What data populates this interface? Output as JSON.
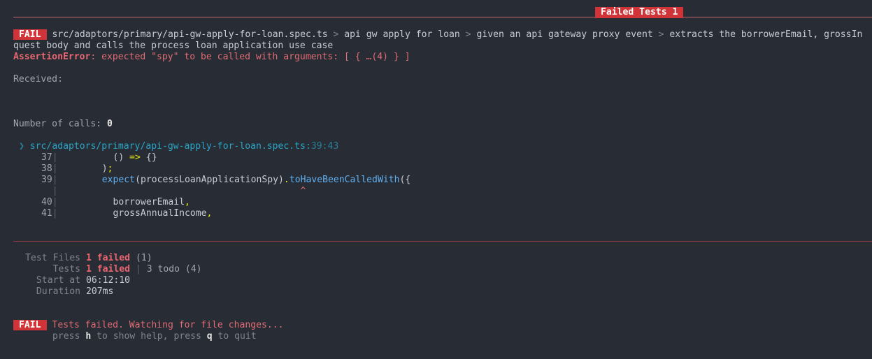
{
  "header": {
    "title": "Failed Tests 1"
  },
  "failure": {
    "badge": "FAIL",
    "file": "src/adaptors/primary/api-gw-apply-for-loan.spec.ts",
    "separator": ">",
    "suite": "api gw apply for loan",
    "describe": "given an api gateway proxy event",
    "test_line1": "extracts the borrowerEmail, grossIn",
    "test_line2": "quest body and calls the process loan application use case",
    "error_name": "AssertionError",
    "error_message": ": expected \"spy\" to be called with arguments: [ { …(4) } ]",
    "received_label": "Received:",
    "calls_label": "Number of calls: ",
    "calls_value": "0"
  },
  "location": {
    "arrow": "❯",
    "file": "src/adaptors/primary/api-gw-apply-for-loan.spec.ts:",
    "position": "39:43"
  },
  "code": {
    "lines": [
      {
        "num": "37",
        "indent": "          ",
        "parts": [
          "() ",
          "=>",
          " {}"
        ]
      },
      {
        "num": "38",
        "indent": "        ",
        "parts": [
          ")",
          ";"
        ]
      },
      {
        "num": "39",
        "indent": "        ",
        "parts": [
          "expect",
          "(processLoanApplicationSpy)",
          ".",
          "toHaveBeenCalledWith",
          "({"
        ]
      },
      {
        "num": "40",
        "indent": "          ",
        "parts": [
          "borrowerEmail",
          ","
        ]
      },
      {
        "num": "41",
        "indent": "          ",
        "parts": [
          "grossAnnualIncome",
          ","
        ]
      }
    ],
    "caret": "^"
  },
  "summary": {
    "test_files_label": "Test Files",
    "test_files_failed": "1 failed",
    "test_files_total": " (1)",
    "tests_label": "Tests",
    "tests_failed": "1 failed",
    "tests_sep": " | ",
    "tests_rest": "3 todo (4)",
    "start_label": "Start at",
    "start_value": "06:12:10",
    "duration_label": "Duration",
    "duration_value": "207ms"
  },
  "footer": {
    "badge": "FAIL",
    "message": "Tests failed. Watching for file changes...",
    "hint_press1": "press ",
    "hint_key1": "h",
    "hint_mid": " to show help, press ",
    "hint_key2": "q",
    "hint_end": " to quit"
  }
}
